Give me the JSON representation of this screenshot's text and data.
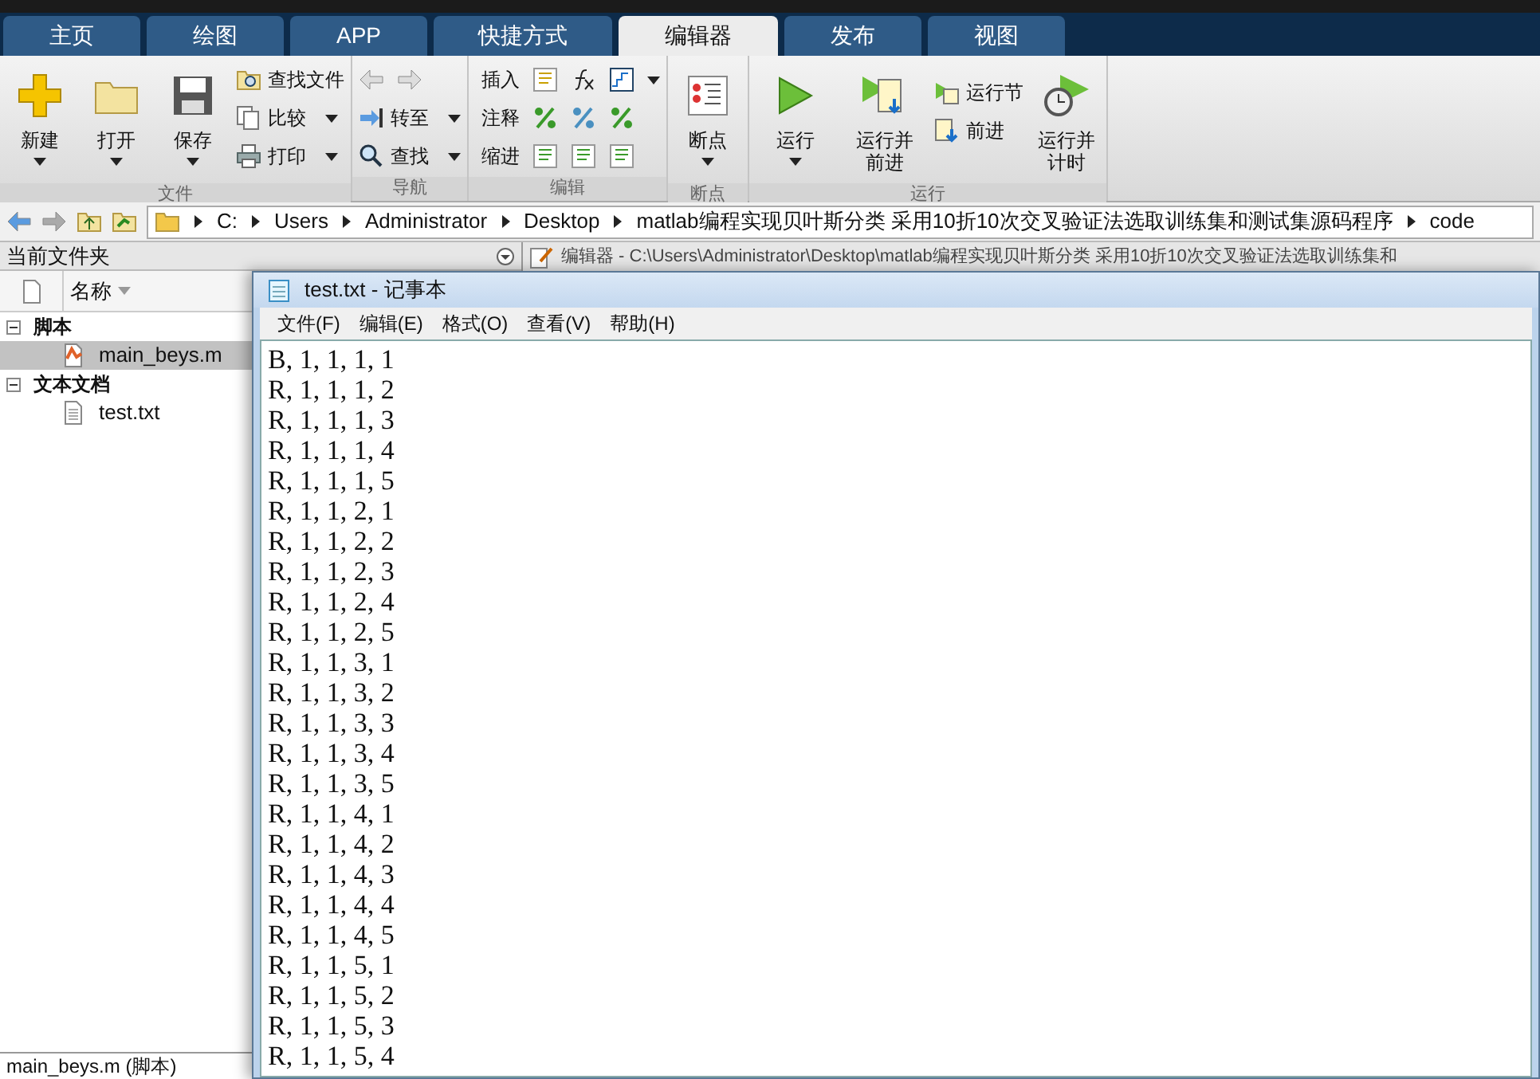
{
  "tabs": [
    {
      "label": "主页",
      "selected": false
    },
    {
      "label": "绘图",
      "selected": false
    },
    {
      "label": "APP",
      "selected": false
    },
    {
      "label": "快捷方式",
      "selected": false
    },
    {
      "label": "编辑器",
      "selected": true
    },
    {
      "label": "发布",
      "selected": false
    },
    {
      "label": "视图",
      "selected": false
    }
  ],
  "ribbon": {
    "file": {
      "label": "文件",
      "large": [
        {
          "label": "新建",
          "dropdown": true
        },
        {
          "label": "打开",
          "dropdown": true
        },
        {
          "label": "保存",
          "dropdown": true
        }
      ],
      "small": [
        {
          "label": "查找文件",
          "dropdown": false
        },
        {
          "label": "比较",
          "dropdown": true
        },
        {
          "label": "打印",
          "dropdown": true
        }
      ]
    },
    "navigate": {
      "label": "导航",
      "small": [
        {
          "label": "转至",
          "dropdown": true
        },
        {
          "label": "查找",
          "dropdown": true
        }
      ]
    },
    "edit": {
      "label": "编辑",
      "rows": [
        {
          "label": "插入",
          "dropdown": true
        },
        {
          "label": "注释",
          "dropdown": false
        },
        {
          "label": "缩进",
          "dropdown": false
        }
      ]
    },
    "breakpoints": {
      "label": "断点",
      "large": [
        {
          "label": "断点",
          "dropdown": true
        }
      ]
    },
    "run": {
      "label": "运行",
      "large": [
        {
          "label": "运行",
          "dropdown": true
        },
        {
          "label": "运行并前进",
          "dropdown": false
        }
      ],
      "small": [
        {
          "label": "运行节"
        },
        {
          "label": "前进"
        }
      ],
      "after": [
        {
          "label": "运行并计时",
          "dropdown": false
        }
      ]
    }
  },
  "address_bar": {
    "path": [
      "C:",
      "Users",
      "Administrator",
      "Desktop",
      "matlab编程实现贝叶斯分类 采用10折10次交叉验证法选取训练集和测试集源码程序",
      "code"
    ]
  },
  "current_folder": {
    "title": "当前文件夹",
    "column": "名称",
    "groups": [
      {
        "label": "脚本",
        "expanded": true,
        "children": [
          {
            "name": "main_beys.m",
            "selected": true
          }
        ]
      },
      {
        "label": "文本文档",
        "expanded": true,
        "children": [
          {
            "name": "test.txt",
            "selected": false
          }
        ]
      }
    ],
    "status": "main_beys.m  (脚本)"
  },
  "editor": {
    "title": "编辑器 - C:\\Users\\Administrator\\Desktop\\matlab编程实现贝叶斯分类 采用10折10次交叉验证法选取训练集和"
  },
  "notepad": {
    "title": "test.txt - 记事本",
    "menu": [
      "文件(F)",
      "编辑(E)",
      "格式(O)",
      "查看(V)",
      "帮助(H)"
    ],
    "lines": [
      "B, 1, 1, 1, 1",
      "R, 1, 1, 1, 2",
      "R, 1, 1, 1, 3",
      "R, 1, 1, 1, 4",
      "R, 1, 1, 1, 5",
      "R, 1, 1, 2, 1",
      "R, 1, 1, 2, 2",
      "R, 1, 1, 2, 3",
      "R, 1, 1, 2, 4",
      "R, 1, 1, 2, 5",
      "R, 1, 1, 3, 1",
      "R, 1, 1, 3, 2",
      "R, 1, 1, 3, 3",
      "R, 1, 1, 3, 4",
      "R, 1, 1, 3, 5",
      "R, 1, 1, 4, 1",
      "R, 1, 1, 4, 2",
      "R, 1, 1, 4, 3",
      "R, 1, 1, 4, 4",
      "R, 1, 1, 4, 5",
      "R, 1, 1, 5, 1",
      "R, 1, 1, 5, 2",
      "R, 1, 1, 5, 3",
      "R, 1, 1, 5, 4"
    ]
  }
}
